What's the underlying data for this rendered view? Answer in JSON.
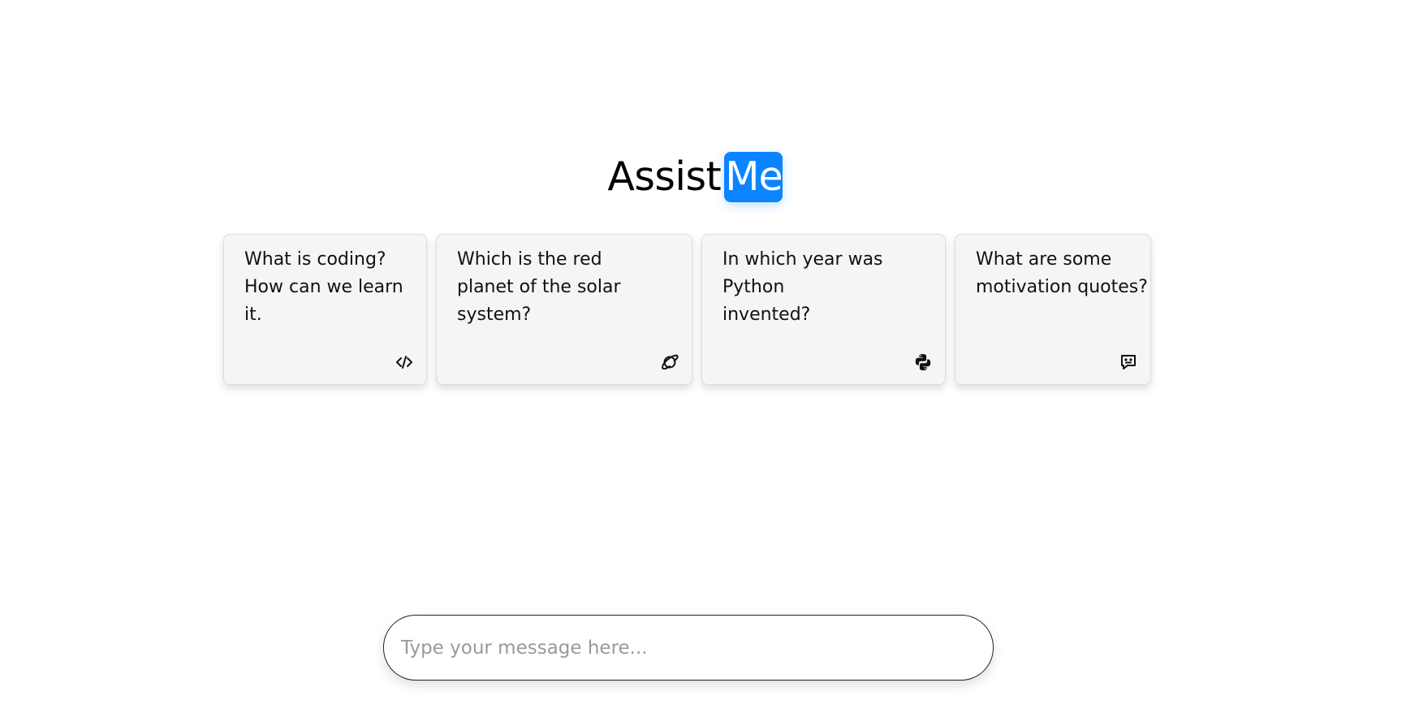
{
  "logo": {
    "part1": "Assist",
    "part2": "Me",
    "accent": "#0a84ff"
  },
  "cards": [
    {
      "text": "What is coding?\nHow can we learn it.",
      "icon": "code-icon"
    },
    {
      "text": "Which is the red\nplanet of the solar system?",
      "icon": "planet-icon"
    },
    {
      "text": "In which year was Python\ninvented?",
      "icon": "python-icon"
    },
    {
      "text": "What are some\nmotivation quotes?",
      "icon": "message-icon"
    }
  ],
  "input": {
    "placeholder": "Type your message here...",
    "value": ""
  }
}
